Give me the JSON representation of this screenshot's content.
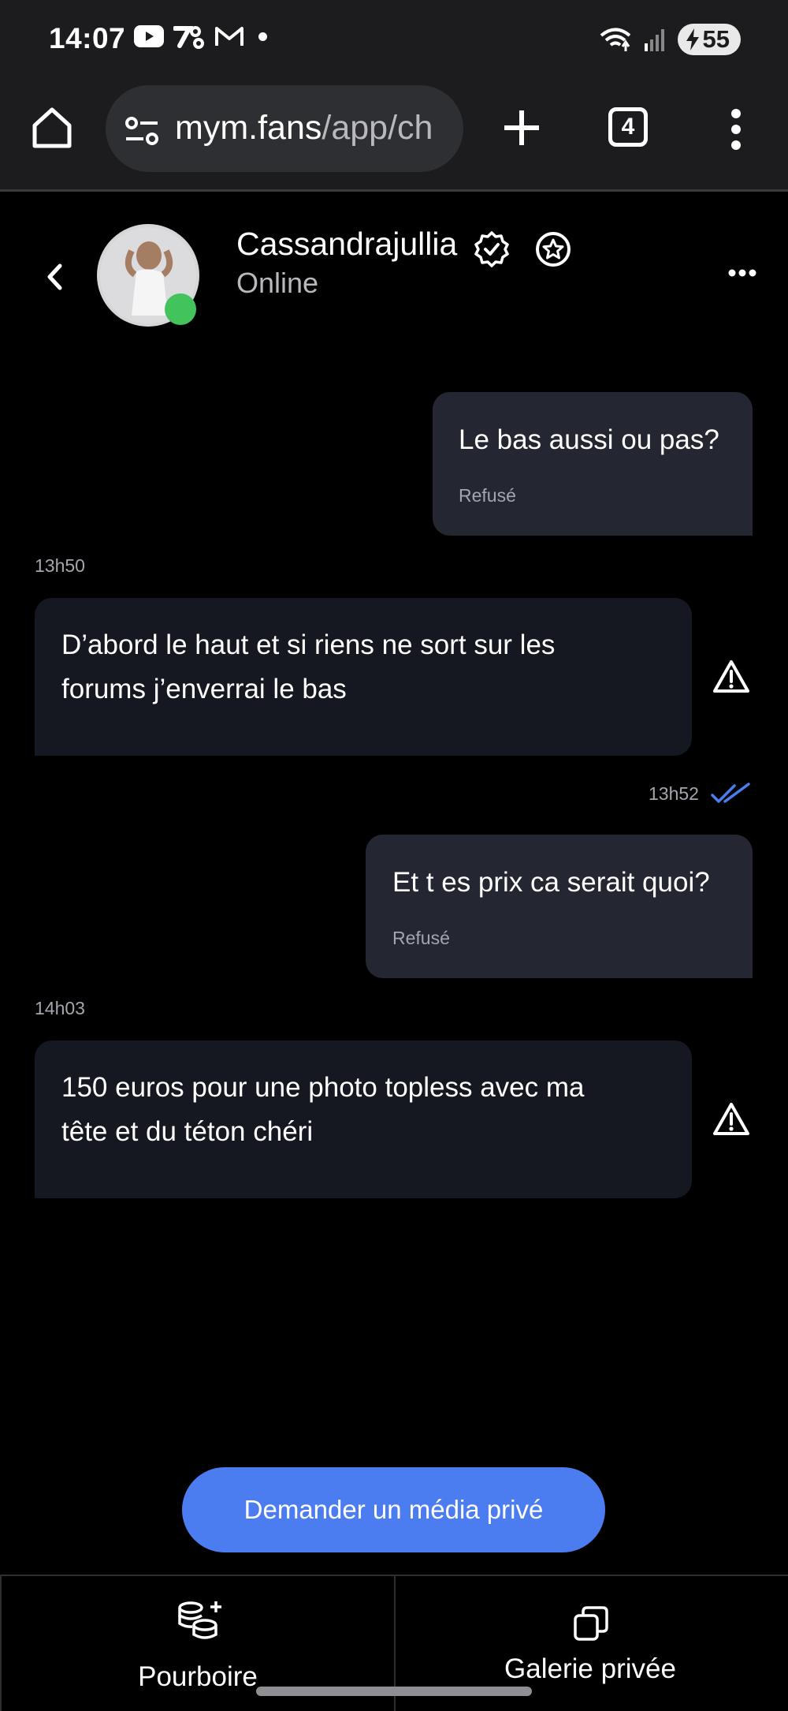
{
  "status_bar": {
    "time": "14:07",
    "battery": "55"
  },
  "browser": {
    "url_host": "mym.fans",
    "url_path": "/app/ch",
    "tab_count": "4"
  },
  "chat": {
    "contact_name": "Cassandrajullia",
    "status": "Online",
    "messages": [
      {
        "direction": "out",
        "text": "Le bas aussi ou pas?",
        "status": "Refusé"
      },
      {
        "direction": "in",
        "time": "13h50",
        "lines": [
          "D’abord le haut et si riens ne sort sur les",
          "forums j’enverrai le bas"
        ]
      },
      {
        "direction": "out",
        "time": "13h52",
        "text": "Et t es prix ca serait quoi?",
        "status": "Refusé"
      },
      {
        "direction": "in",
        "time": "14h03",
        "lines": [
          "150 euros pour une photo topless avec ma",
          "tête et du téton chéri"
        ]
      }
    ]
  },
  "actions": {
    "request_media": "Demander un média privé",
    "tip": "Pourboire",
    "private_gallery": "Galerie privée"
  },
  "colors": {
    "accent": "#4c7df0",
    "online": "#43c35c",
    "bubble_out": "#242631",
    "bubble_in": "#161821"
  },
  "icons": [
    "youtube-icon",
    "perplexity-icon",
    "gmail-icon",
    "wifi-icon",
    "signal-icon",
    "home-icon",
    "tune-icon",
    "plus-icon",
    "tabs-icon",
    "kebab-menu-icon",
    "back-icon",
    "verified-icon",
    "star-icon",
    "more-icon",
    "warning-icon",
    "double-check-icon",
    "coins-plus-icon",
    "gallery-icon"
  ]
}
